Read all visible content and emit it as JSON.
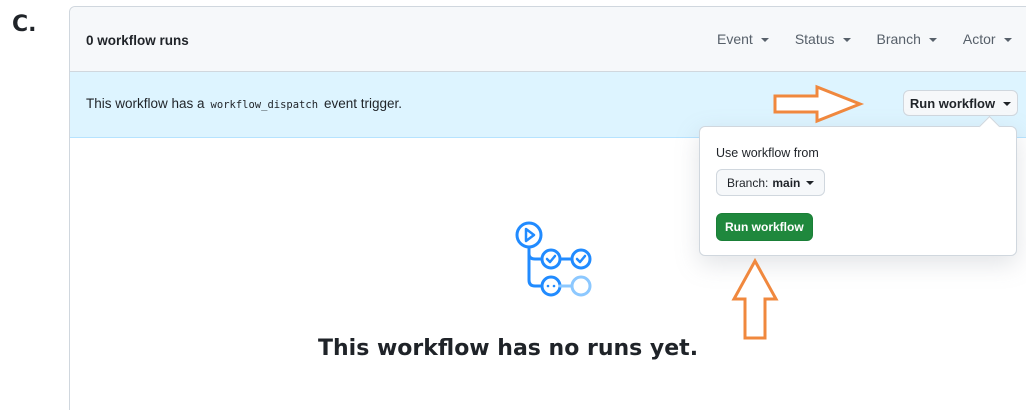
{
  "step_label": "C.",
  "header": {
    "runs_count": "0 workflow runs",
    "filters": [
      {
        "label": "Event"
      },
      {
        "label": "Status"
      },
      {
        "label": "Branch"
      },
      {
        "label": "Actor"
      }
    ]
  },
  "dispatch_bar": {
    "text_before": "This workflow has a",
    "code": "workflow_dispatch",
    "text_after": "event trigger.",
    "run_button_label": "Run workflow"
  },
  "dropdown": {
    "heading": "Use workflow from",
    "branch_prefix": "Branch:",
    "branch_value": "main",
    "run_button_label": "Run workflow"
  },
  "empty_state": {
    "title": "This workflow has no runs yet."
  },
  "colors": {
    "accent_blue": "#218bff",
    "run_green": "#1f883d",
    "annotation_orange": "#f0883e",
    "info_bar": "#ddf4ff"
  },
  "icons": {
    "empty_state": "workflow-graph-icon",
    "annotation_right": "arrow-right-annotation",
    "annotation_up": "arrow-up-annotation"
  }
}
